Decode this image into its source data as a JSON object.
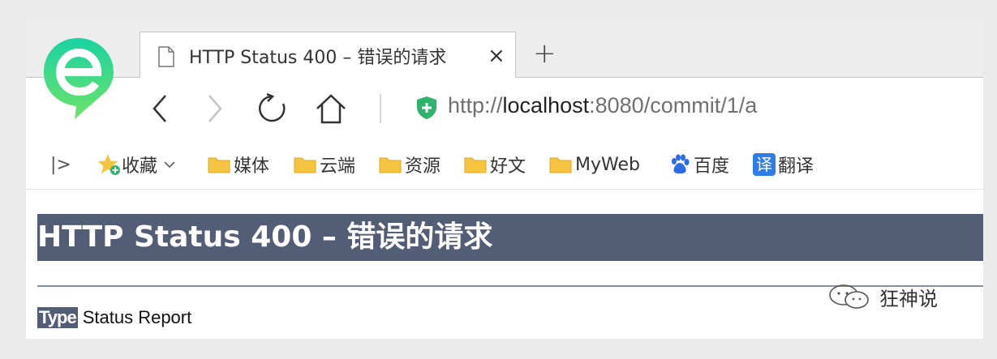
{
  "browser": {
    "tab": {
      "title": "HTTP Status 400 – 错误的请求",
      "close_glyph": "×"
    },
    "new_tab_glyph": "+",
    "address": {
      "scheme": "http://",
      "host": "localhost",
      "rest": ":8080/commit/1/a"
    }
  },
  "bookmarks": {
    "toggle_glyph": "|>",
    "items": [
      {
        "label": "收藏",
        "icon": "star-icon"
      },
      {
        "label": "媒体",
        "icon": "folder-icon"
      },
      {
        "label": "云端",
        "icon": "folder-icon"
      },
      {
        "label": "资源",
        "icon": "folder-icon"
      },
      {
        "label": "好文",
        "icon": "folder-icon"
      },
      {
        "label": "MyWeb",
        "icon": "folder-icon"
      },
      {
        "label": "百度",
        "icon": "baidu-paw-icon"
      },
      {
        "label": "翻译",
        "icon": "translate-icon",
        "icon_text": "译"
      }
    ]
  },
  "page": {
    "heading": "HTTP Status 400 – 错误的请求",
    "type_label": "Type",
    "type_value": "Status Report"
  },
  "watermark": {
    "text": "狂神说"
  },
  "colors": {
    "header_bg": "#525d76",
    "folder": "#f5c542",
    "shield": "#2fb36b",
    "logo_green": "#19d3a2"
  }
}
